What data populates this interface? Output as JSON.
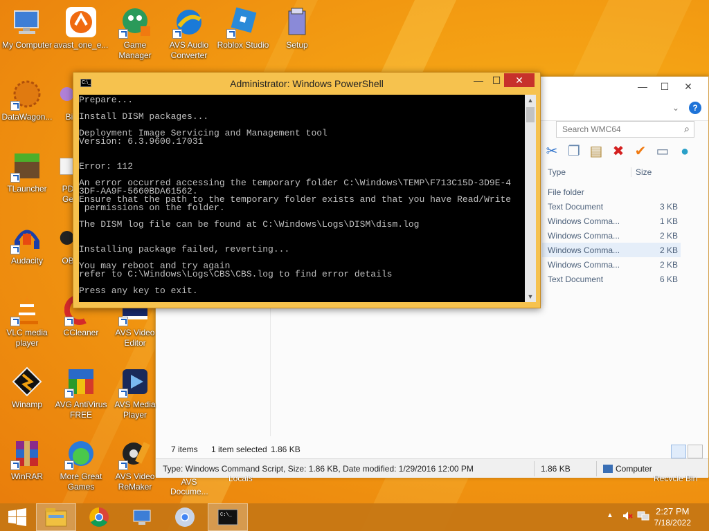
{
  "desktop": {
    "icons": [
      {
        "label": "My Computer"
      },
      {
        "label": "avast_one_e..."
      },
      {
        "label": "Game Manager"
      },
      {
        "label": "AVS Audio Converter"
      },
      {
        "label": "Roblox Studio"
      },
      {
        "label": "Setup"
      },
      {
        "label": "DataWagon..."
      },
      {
        "label": "Bi"
      },
      {
        "label": "TLauncher"
      },
      {
        "label": "PD Ge"
      },
      {
        "label": "Audacity"
      },
      {
        "label": "OB"
      },
      {
        "label": "VLC media player"
      },
      {
        "label": "CCleaner"
      },
      {
        "label": "AVS Video Editor"
      },
      {
        "label": "Winamp"
      },
      {
        "label": "AVG AntiVirus FREE"
      },
      {
        "label": "AVS Media Player"
      },
      {
        "label": "WinRAR"
      },
      {
        "label": "More Great Games"
      },
      {
        "label": "AVS Video ReMaker"
      },
      {
        "label": "AVS Docume..."
      },
      {
        "label": "Locals"
      },
      {
        "label": "Recycle Bin"
      }
    ]
  },
  "powershell": {
    "title": "Administrator: Windows PowerShell",
    "icon_text": "C:\\_",
    "lines": [
      "Prepare...",
      "",
      "Install DISM packages...",
      "",
      "Deployment Image Servicing and Management tool",
      "Version: 6.3.9600.17031",
      "",
      "",
      "Error: 112",
      "",
      "An error occurred accessing the temporary folder C:\\Windows\\TEMP\\F713C15D-3D9E-4",
      "3DF-AA9F-5660BDA61562.",
      "Ensure that the path to the temporary folder exists and that you have Read/Write",
      " permissions on the folder.",
      "",
      "The DISM log file can be found at C:\\Windows\\Logs\\DISM\\dism.log",
      "",
      "",
      "Installing package failed, reverting...",
      "",
      "You may reboot and try again",
      "refer to C:\\Windows\\Logs\\CBS\\CBS.log to find error details",
      "",
      "Press any key to exit."
    ],
    "buttons": {
      "minimize": "—",
      "maximize": "☐",
      "close": "✕"
    }
  },
  "explorer": {
    "buttons": {
      "minimize": "—",
      "maximize": "☐",
      "close": "✕"
    },
    "search_placeholder": "Search WMC64",
    "columns": {
      "type": "Type",
      "size": "Size"
    },
    "rows": [
      {
        "type": "File folder",
        "size": ""
      },
      {
        "type": "Text Document",
        "size": "3 KB"
      },
      {
        "type": "Windows Comma...",
        "size": "1 KB"
      },
      {
        "type": "Windows Comma...",
        "size": "2 KB"
      },
      {
        "type": "Windows Comma...",
        "size": "2 KB",
        "selected": true
      },
      {
        "type": "Windows Comma...",
        "size": "2 KB"
      },
      {
        "type": "Text Document",
        "size": "6 KB"
      }
    ],
    "status": {
      "items": "7 items",
      "selected": "1 item selected",
      "size": "1.86 KB"
    },
    "details": {
      "info": "Type: Windows Command Script, Size: 1.86 KB, Date modified: 1/29/2016 12:00 PM",
      "size": "1.86 KB",
      "location": "Computer"
    }
  },
  "taskbar": {
    "clock_time": "2:27 PM",
    "clock_date": "7/18/2022"
  },
  "colors": {
    "wallpaper": "#f39c12",
    "taskbar": "#c57614",
    "close_button": "#c7312b",
    "console_bg": "#000000",
    "console_fg": "#c0c0c0"
  }
}
